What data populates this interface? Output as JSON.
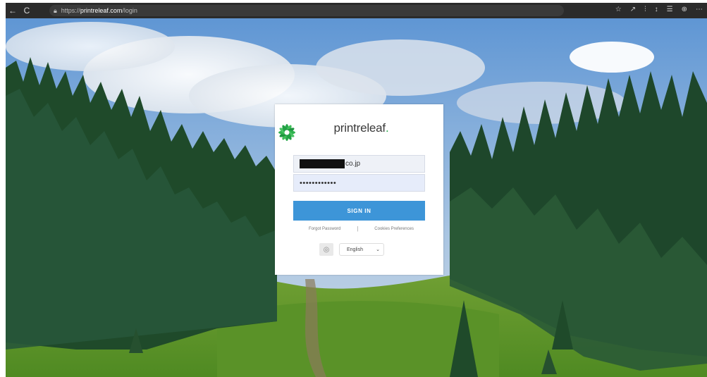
{
  "browser": {
    "back": "←",
    "reload": "C",
    "url_prefix": "https://",
    "url_host": "printreleaf.com",
    "url_path": "/login",
    "toolbar_icons": [
      "☆",
      "↗",
      "⫶",
      "↕",
      "☰",
      "⊕",
      "⋯"
    ]
  },
  "brand": {
    "name_part1": "print",
    "name_part2": "releaf",
    "name_dot": ".",
    "accent_color": "#27a84a"
  },
  "login": {
    "email_visible_suffix": "co.jp",
    "password_mask": "••••••••••••",
    "signin_label": "SIGN IN",
    "forgot_label": "Forgot Password",
    "separator": "|",
    "cookies_label": "Cookies Preferences",
    "language_value": "English",
    "button_color": "#3d95d8"
  }
}
